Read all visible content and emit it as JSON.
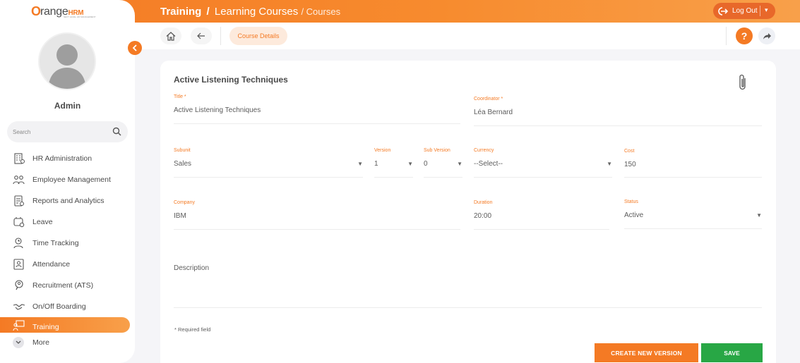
{
  "app": {
    "logo_o": "O",
    "logo_text": "range",
    "logo_hrm": "HRM",
    "logo_tagline": "NEXT LEVEL HR MANAGEMENT"
  },
  "header": {
    "crumb_main": "Training",
    "crumb_sep": "/",
    "crumb_mid": "Learning Courses",
    "crumb_last": "/ Courses",
    "logout_label": "Log Out",
    "logout_caret": "▾"
  },
  "sidebar": {
    "collapse_glyph": "‹",
    "user_name": "Admin",
    "search_placeholder": "Search",
    "items": [
      {
        "label": "HR Administration",
        "icon": "building-icon"
      },
      {
        "label": "Employee Management",
        "icon": "users-icon"
      },
      {
        "label": "Reports and Analytics",
        "icon": "report-icon"
      },
      {
        "label": "Leave",
        "icon": "leave-icon"
      },
      {
        "label": "Time Tracking",
        "icon": "clock-user-icon"
      },
      {
        "label": "Attendance",
        "icon": "attendance-icon"
      },
      {
        "label": "Recruitment (ATS)",
        "icon": "recruitment-icon"
      },
      {
        "label": "On/Off Boarding",
        "icon": "handshake-icon"
      },
      {
        "label": "Training",
        "icon": "training-icon",
        "active": true
      }
    ],
    "more_label": "More"
  },
  "toolbar": {
    "tab_label": "Course Details",
    "help_glyph": "?"
  },
  "form": {
    "title": "Active Listening Techniques",
    "fields": {
      "title": {
        "label": "Title *",
        "value": "Active Listening Techniques"
      },
      "coordinator": {
        "label": "Coordinator *",
        "value": "Léa Bernard"
      },
      "subunit": {
        "label": "Subunit",
        "value": "Sales"
      },
      "version": {
        "label": "Version",
        "value": "1"
      },
      "subversion": {
        "label": "Sub Version",
        "value": "0"
      },
      "currency": {
        "label": "Currency",
        "value": "--Select--"
      },
      "cost": {
        "label": "Cost",
        "value": "150"
      },
      "company": {
        "label": "Company",
        "value": "IBM"
      },
      "duration": {
        "label": "Duration",
        "value": "20:00"
      },
      "status": {
        "label": "Status",
        "value": "Active"
      },
      "description": {
        "label": "Description",
        "value": ""
      }
    },
    "caret": "▼",
    "required_note": "* Required field",
    "create_version_label": "CREATE NEW VERSION",
    "save_label": "SAVE"
  },
  "colors": {
    "accent": "#f47a24",
    "save": "#28a745"
  }
}
